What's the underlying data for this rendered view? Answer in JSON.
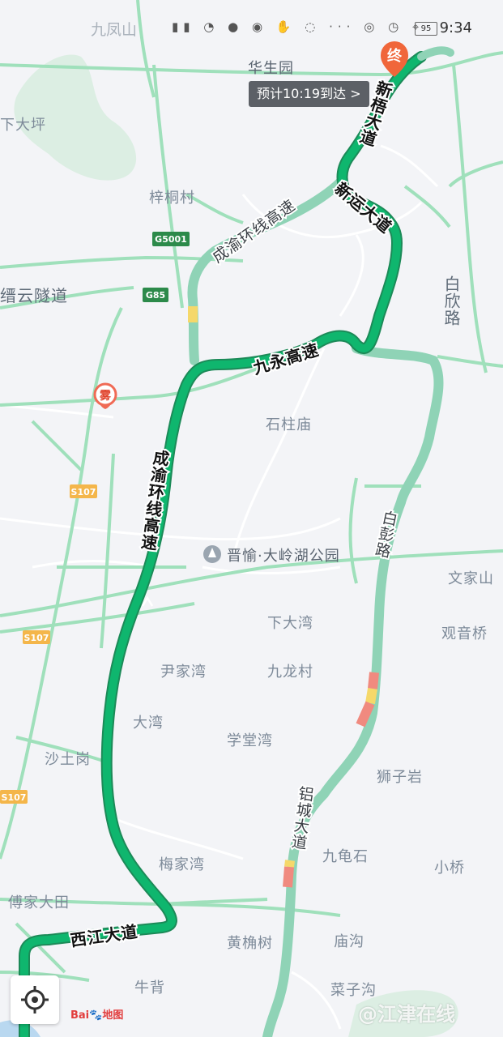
{
  "status_bar": {
    "left_text": "九凤山",
    "time": "9:34",
    "battery": "95"
  },
  "eta_label": "预计10:19到达 >",
  "end_marker": "终",
  "fog_marker": "雾",
  "poi_name": "晋愉·大岭湖公园",
  "road_labels": {
    "xintuo": "新梧大道",
    "xinyun": "新运大道",
    "chengyu_top": "成渝环线高速",
    "jiuyong": "九永高速",
    "chengyu_main": "成渝环线高速",
    "baipeng": "白彭路",
    "lvcheng": "铝城大道",
    "xijiang": "西江大道",
    "baixin": "白欣路",
    "jinyun": "缙云隧道"
  },
  "shields": [
    "G5001",
    "G85",
    "S107",
    "S107",
    "S107"
  ],
  "places": {
    "huasheng": "华生园",
    "xiadaping": "下大坪",
    "zitong": "梓桐村",
    "shizhu": "石柱庙",
    "wenjiashan": "文家山",
    "xiadawan": "下大湾",
    "guanyinqiao": "观音桥",
    "yinjiawan": "尹家湾",
    "jiulong": "九龙村",
    "dawan": "大湾",
    "xuetangwan": "学堂湾",
    "shatugang": "沙土岗",
    "shiziyan": "狮子岩",
    "jiuguishi": "九龟石",
    "xiaoqiao": "小桥",
    "meijiawan": "梅家湾",
    "fujiadatian": "傅家大田",
    "huangjiaoshu": "黄桷树",
    "miaogou": "庙沟",
    "niubei": "牛背",
    "caizigou": "菜子沟"
  },
  "branding": {
    "logo_a": "Bai",
    "logo_b": "地图",
    "watermark": "@江津在线"
  },
  "colors": {
    "primary_route": "#0fb66e",
    "alt_route": "#8fd3b6",
    "jam_red": "#f08a7f",
    "slow_yellow": "#f5d86a",
    "end_marker": "#f0663a"
  }
}
